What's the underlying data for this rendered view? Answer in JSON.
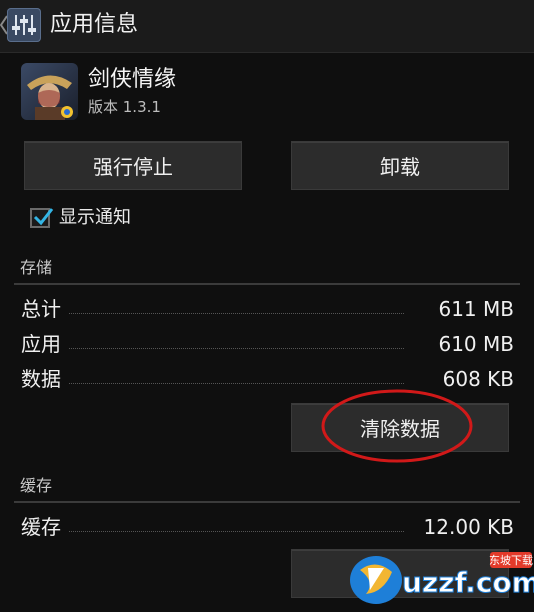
{
  "actionbar": {
    "title": "应用信息",
    "icon": "settings-sliders-icon"
  },
  "app": {
    "name": "剑侠情缘",
    "version": "版本 1.3.1",
    "icon": "game-app-icon"
  },
  "buttons": {
    "force_stop": "强行停止",
    "uninstall": "卸载",
    "clear_data": "清除数据"
  },
  "notification": {
    "label": "显示通知",
    "checked": true
  },
  "storage": {
    "header": "存储",
    "rows": [
      {
        "label": "总计",
        "value": "611 MB"
      },
      {
        "label": "应用",
        "value": "610 MB"
      },
      {
        "label": "数据",
        "value": "608 KB"
      }
    ]
  },
  "cache": {
    "header": "缓存",
    "rows": [
      {
        "label": "缓存",
        "value": "12.00 KB"
      }
    ]
  },
  "watermark": {
    "brand": "uzzf.com",
    "tag": "东坡下载"
  },
  "colors": {
    "annotation": "#d11919",
    "checkbox_check": "#33b5e5"
  }
}
